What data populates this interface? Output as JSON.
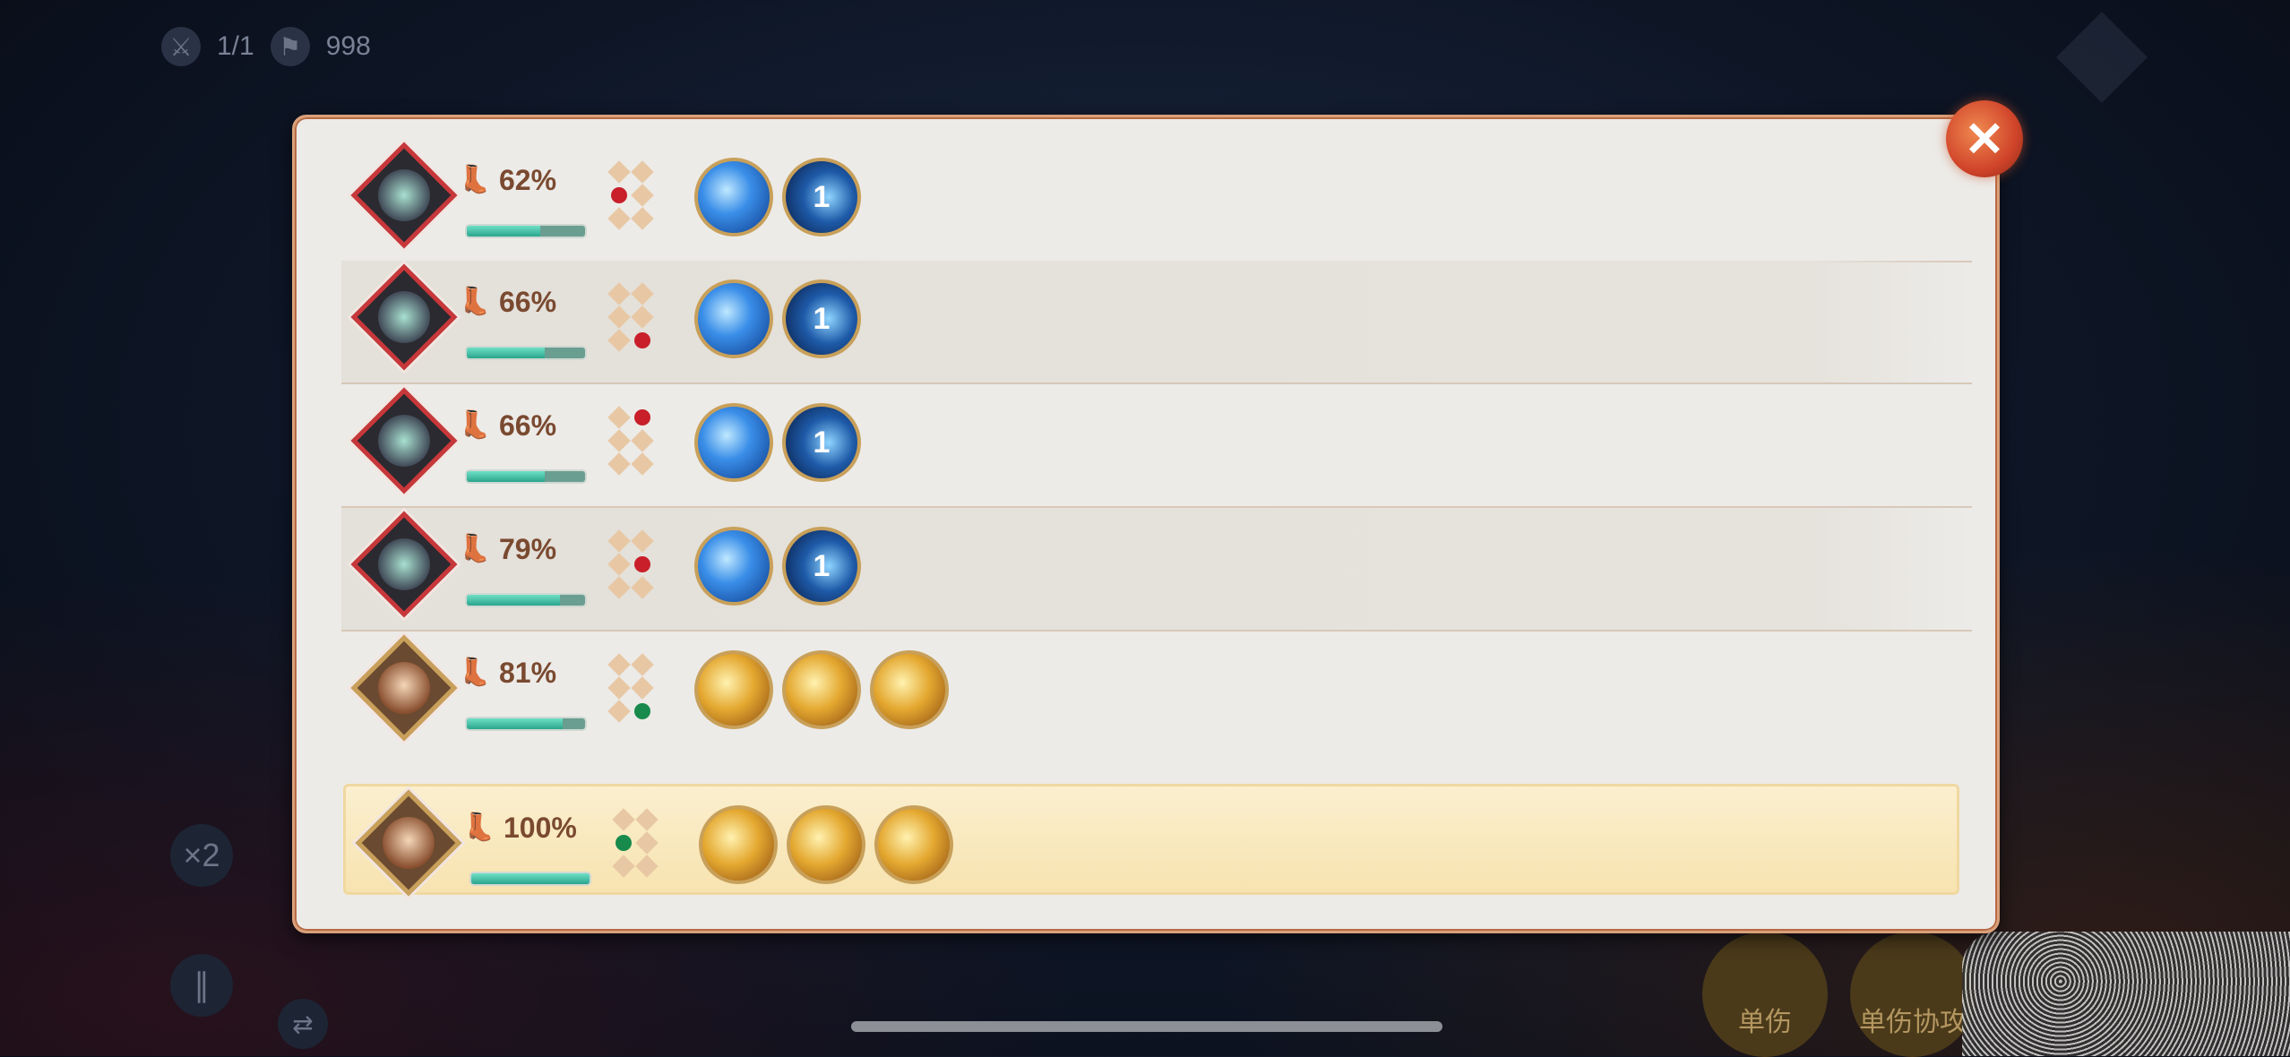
{
  "hud": {
    "round_icon": "crossed-swords-icon",
    "round_text": "1/1",
    "flag_icon": "flag-icon",
    "flag_count": "998",
    "speed_mult_label": "×2",
    "pause_icon": "pause-icon",
    "switch_icon": "swap-arrows-icon",
    "bottom_buttons": [
      "单伤",
      "单伤协攻"
    ]
  },
  "panel": {
    "close_icon": "close-icon",
    "close_label": "✕",
    "rows": [
      {
        "portrait": "hooded-robot-portrait",
        "frame": "red",
        "speed": "62%",
        "speed_value": 62,
        "dot_active": "row2-left",
        "dot_color": "red",
        "skills": [
          {
            "icon": "blue-slash-skill-icon",
            "style": "blue",
            "label": ""
          },
          {
            "icon": "blue-swirl-skill-icon",
            "style": "blue-dark",
            "label": "1"
          }
        ]
      },
      {
        "portrait": "hooded-creature-portrait",
        "frame": "red",
        "speed": "66%",
        "speed_value": 66,
        "dot_active": "row3-right",
        "dot_color": "red",
        "skills": [
          {
            "icon": "blue-slash-skill-icon",
            "style": "blue",
            "label": ""
          },
          {
            "icon": "blue-swirl-skill-icon",
            "style": "blue-dark",
            "label": "1"
          }
        ]
      },
      {
        "portrait": "hooded-creature-portrait",
        "frame": "red",
        "speed": "66%",
        "speed_value": 66,
        "dot_active": "row1-right",
        "dot_color": "red",
        "skills": [
          {
            "icon": "blue-slash-skill-icon",
            "style": "blue",
            "label": ""
          },
          {
            "icon": "blue-swirl-skill-icon",
            "style": "blue-dark",
            "label": "1"
          }
        ]
      },
      {
        "portrait": "white-beast-portrait",
        "frame": "red",
        "speed": "79%",
        "speed_value": 79,
        "dot_active": "row2-right",
        "dot_color": "red",
        "skills": [
          {
            "icon": "blue-arrow-skill-icon",
            "style": "blue",
            "label": ""
          },
          {
            "icon": "blue-swirl-skill-icon",
            "style": "blue-dark",
            "label": "1"
          }
        ]
      },
      {
        "portrait": "red-haired-hero-portrait",
        "frame": "gold",
        "speed": "81%",
        "speed_value": 81,
        "dot_active": "row3-right",
        "dot_color": "green",
        "skills": [
          {
            "icon": "gold-claw-skill-icon",
            "style": "gold",
            "label": ""
          },
          {
            "icon": "gold-warrior-skill-icon",
            "style": "gold",
            "label": ""
          },
          {
            "icon": "gold-flame-skill-icon",
            "style": "gold",
            "label": ""
          }
        ]
      },
      {
        "portrait": "dark-haired-hero-portrait",
        "frame": "gold",
        "speed": "100%",
        "speed_value": 100,
        "dot_active": "row2-left",
        "dot_color": "green",
        "active": true,
        "skills": [
          {
            "icon": "gold-orb-skill-icon",
            "style": "gold",
            "label": ""
          },
          {
            "icon": "gold-feather-skill-icon",
            "style": "gold",
            "label": ""
          },
          {
            "icon": "gold-spark-skill-icon",
            "style": "gold",
            "label": ""
          }
        ]
      }
    ]
  },
  "colors": {
    "panel_bg": "#ecebe8",
    "panel_border": "#d9a07a",
    "enemy_frame": "#c8373a",
    "ally_frame": "#c8a05a",
    "speed_bar": "#2aa58c",
    "active_row_bg": "#f7e3b0",
    "close_button": "#d0442a"
  }
}
